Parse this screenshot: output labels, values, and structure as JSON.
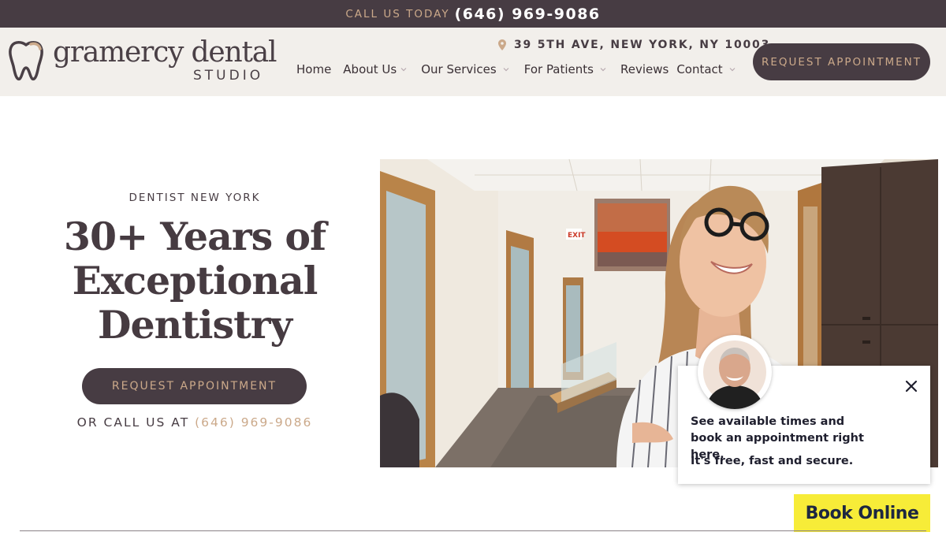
{
  "topbar": {
    "label": "CALL US TODAY",
    "phone": "(646) 969-9086"
  },
  "header": {
    "logo": {
      "wordmark": "gramercy dental",
      "sub": "STUDIO",
      "icon": "tooth-icon"
    },
    "address": {
      "icon": "map-pin-icon",
      "text": "39 5TH AVE, NEW YORK, NY 10003"
    },
    "nav": [
      {
        "label": "Home",
        "has_dropdown": false
      },
      {
        "label": "About Us",
        "has_dropdown": true
      },
      {
        "label": "Our Services",
        "has_dropdown": true
      },
      {
        "label": "For Patients",
        "has_dropdown": true
      },
      {
        "label": "Reviews",
        "has_dropdown": false
      },
      {
        "label": "Contact",
        "has_dropdown": true
      }
    ],
    "cta": "REQUEST APPOINTMENT"
  },
  "hero": {
    "eyebrow": "DENTIST NEW YORK",
    "title_lines": [
      "30+ Years of",
      "Exceptional",
      "Dentistry"
    ],
    "button": "REQUEST APPOINTMENT",
    "call_prefix": "OR CALL US AT",
    "call_phone": "(646) 969-9086"
  },
  "popup": {
    "message": "See available times and book an appointment right here.",
    "message2": "It's free, fast and secure.",
    "close_icon": "close-icon",
    "avatar_icon": "doctor-avatar"
  },
  "book_online": "Book Online",
  "colors": {
    "primary": "#473c43",
    "accent": "#cba98a",
    "header_bg": "#f2efeb",
    "book_btn": "#f7ec38"
  }
}
